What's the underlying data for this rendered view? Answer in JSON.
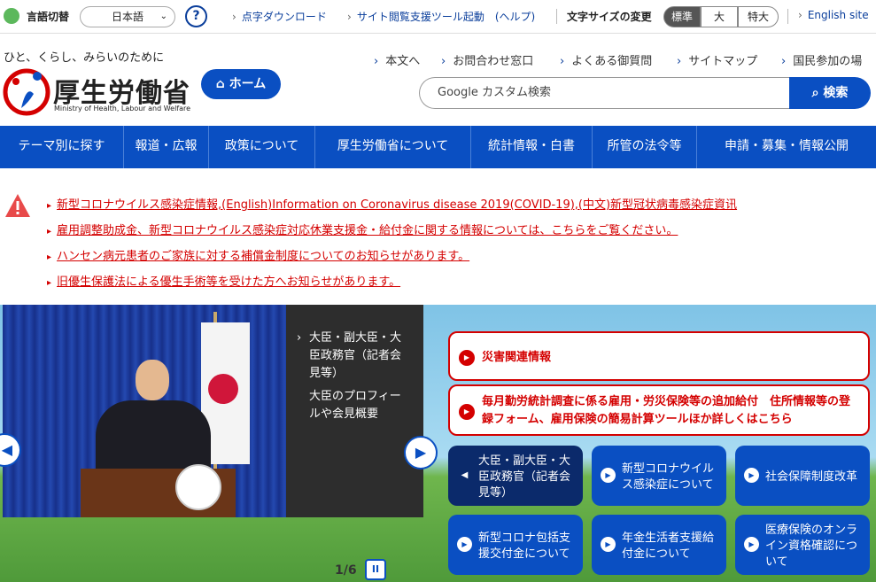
{
  "util": {
    "lang_label": "言語切替",
    "lang_value": "日本語",
    "help_symbol": "?",
    "links": [
      "点字ダウンロード",
      "サイト閲覧支援ツール起動　(ヘルプ)"
    ],
    "font_size_label": "文字サイズの変更",
    "font_sizes": [
      "標準",
      "大",
      "特大"
    ],
    "english": "English site"
  },
  "header": {
    "tagline": "ひと、くらし、みらいのために",
    "org_name": "厚生労働省",
    "org_name_en": "Ministry of Health, Labour and Welfare",
    "home": "ホーム",
    "links": [
      "本文へ",
      "お問合わせ窓口",
      "よくある御質問",
      "サイトマップ",
      "国民参加の場"
    ],
    "search_placeholder": "Google カスタム検索",
    "search_button": "検索"
  },
  "nav": [
    "テーマ別に探す",
    "報道・広報",
    "政策について",
    "厚生労働省について",
    "統計情報・白書",
    "所管の法令等",
    "申請・募集・情報公開"
  ],
  "alerts": [
    "新型コロナウイルス感染症情報,(English)Information on Coronavirus disease 2019(COVID-19),(中文)新型冠状病毒感染症資讯",
    "雇用調整助成金、新型コロナウイルス感染症対応休業支援金・給付金に関する情報については、こちらをご覧ください。",
    "ハンセン病元患者のご家族に対する補償金制度についてのお知らせがあります。",
    "旧優生保護法による優生手術等を受けた方へお知らせがあります。"
  ],
  "carousel": {
    "caption_title": "大臣・副大臣・大臣政務官（記者会見等）",
    "caption_body": "大臣のプロフィールや会見概要",
    "pager": "1/6",
    "pause": "II"
  },
  "red_boxes": [
    "災害関連情報",
    "毎月勤労統計調査に係る雇用・労災保険等の追加給付　住所情報等の登録フォーム、雇用保険の簡易計算ツールほか詳しくはこちら"
  ],
  "tiles": [
    "大臣・副大臣・大臣政務官（記者会見等）",
    "新型コロナウイルス感染症について",
    "社会保障制度改革",
    "新型コロナ包括支援交付金について",
    "年金生活者支援給付金について",
    "医療保険のオンライン資格確認について"
  ],
  "colors": {
    "brand_blue": "#0a4fc2",
    "alert_red": "#d40000",
    "active_tile": "#0b2a6b"
  }
}
